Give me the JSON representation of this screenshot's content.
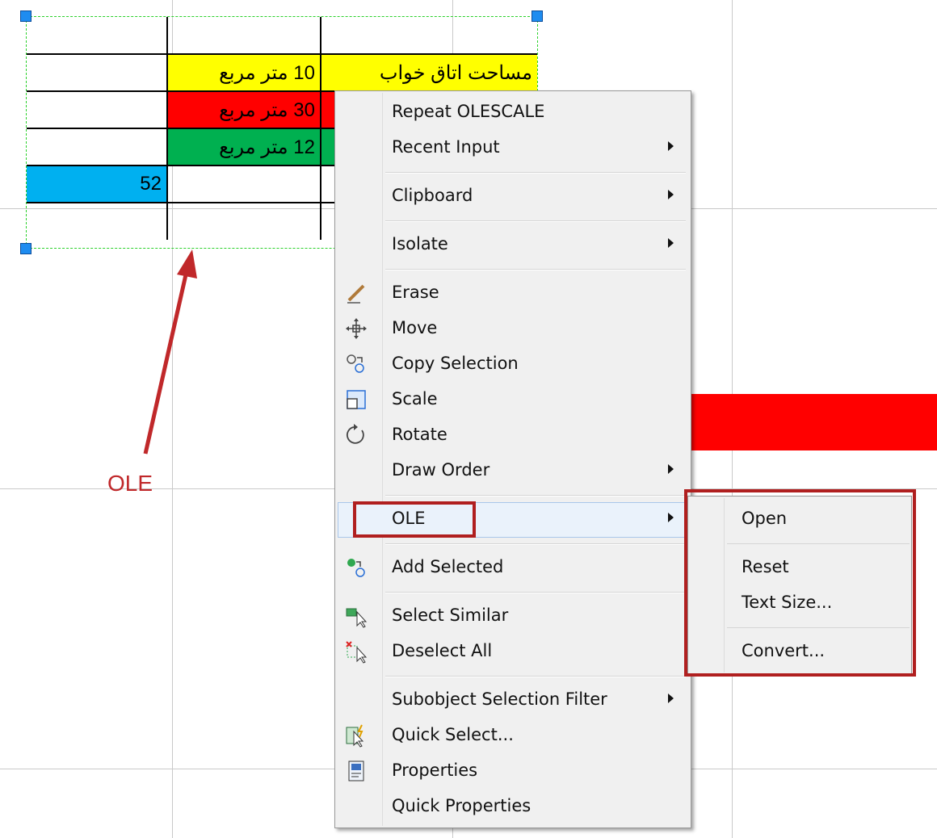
{
  "colors": {
    "yellow": "#ffff00",
    "red": "#ff0000",
    "green": "#00b050",
    "blue": "#00b0f0",
    "annotation_red": "#b01f1f"
  },
  "ole_table": {
    "rows": [
      [
        "",
        "",
        ""
      ],
      [
        "",
        "10  متر مربع",
        "مساحت اتاق خواب"
      ],
      [
        "",
        "30  متر مربع",
        ""
      ],
      [
        "",
        "12  متر مربع",
        ""
      ],
      [
        "52",
        "",
        ""
      ],
      [
        "",
        "",
        ""
      ]
    ]
  },
  "annotation": {
    "ole_label": "OLE"
  },
  "context_menu": {
    "items": [
      {
        "label": "Repeat OLESCALE",
        "icon": "",
        "submenu": false
      },
      {
        "label": "Recent Input",
        "icon": "",
        "submenu": true
      },
      {
        "label": "Clipboard",
        "icon": "",
        "submenu": true
      },
      {
        "label": "Isolate",
        "icon": "",
        "submenu": true
      },
      {
        "label": "Erase",
        "icon": "eraser-icon",
        "submenu": false
      },
      {
        "label": "Move",
        "icon": "move-icon",
        "submenu": false
      },
      {
        "label": "Copy Selection",
        "icon": "copy-icon",
        "submenu": false
      },
      {
        "label": "Scale",
        "icon": "scale-icon",
        "submenu": false
      },
      {
        "label": "Rotate",
        "icon": "rotate-icon",
        "submenu": false
      },
      {
        "label": "Draw Order",
        "icon": "",
        "submenu": true
      },
      {
        "label": "OLE",
        "icon": "",
        "submenu": true
      },
      {
        "label": "Add Selected",
        "icon": "add-selected-icon",
        "submenu": false
      },
      {
        "label": "Select Similar",
        "icon": "select-similar-icon",
        "submenu": false
      },
      {
        "label": "Deselect All",
        "icon": "deselect-all-icon",
        "submenu": false
      },
      {
        "label": "Subobject Selection Filter",
        "icon": "",
        "submenu": true
      },
      {
        "label": "Quick Select...",
        "icon": "quick-select-icon",
        "submenu": false
      },
      {
        "label": "Properties",
        "icon": "properties-icon",
        "submenu": false
      },
      {
        "label": "Quick Properties",
        "icon": "",
        "submenu": false
      }
    ]
  },
  "ole_submenu": {
    "items": [
      {
        "label": "Open"
      },
      {
        "label": "Reset"
      },
      {
        "label": "Text Size..."
      },
      {
        "label": "Convert..."
      }
    ]
  }
}
